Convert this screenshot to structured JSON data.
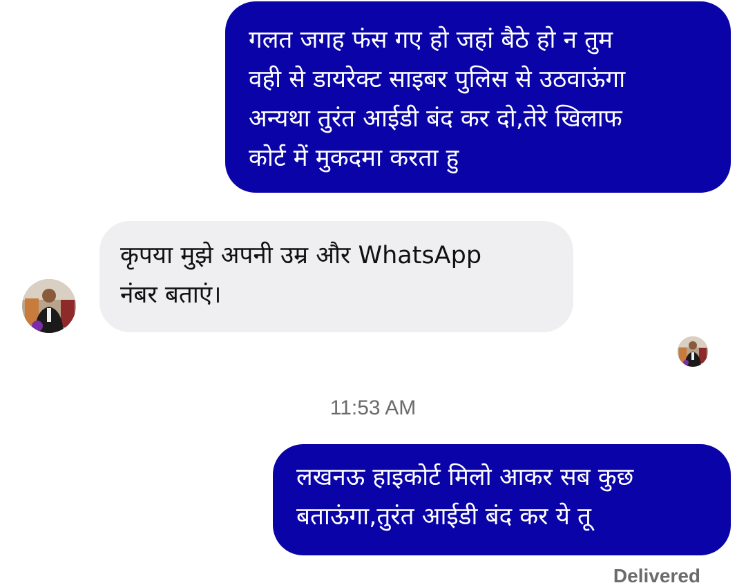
{
  "conversation": {
    "messages": [
      {
        "direction": "outgoing",
        "text": "गलत जगह फंस गए हो जहां बैठे हो न तुम\nवही से डायरेक्ट साइबर पुलिस से उठवाऊंगा\nअन्यथा तुरंत आईडी बंद कर दो,तेरे खिलाफ\nकोर्ट में मुकदमा करता हु"
      },
      {
        "direction": "incoming",
        "text": "कृपया मुझे अपनी उम्र और WhatsApp\nनंबर बताएं।"
      },
      {
        "direction": "outgoing",
        "text": "लखनऊ हाइकोर्ट मिलो आकर सब कुछ\nबताऊंगा,तुरंत आईडी बंद कर ये तू"
      }
    ],
    "timestamp": "11:53 AM",
    "status": "Delivered"
  },
  "colors": {
    "outgoing_bubble": "#0a04a8",
    "incoming_bubble": "#efeff1",
    "meta_text": "#6b6b6b"
  },
  "icons": {
    "contact_avatar": "profile-photo",
    "seen_avatar": "profile-photo-small"
  }
}
